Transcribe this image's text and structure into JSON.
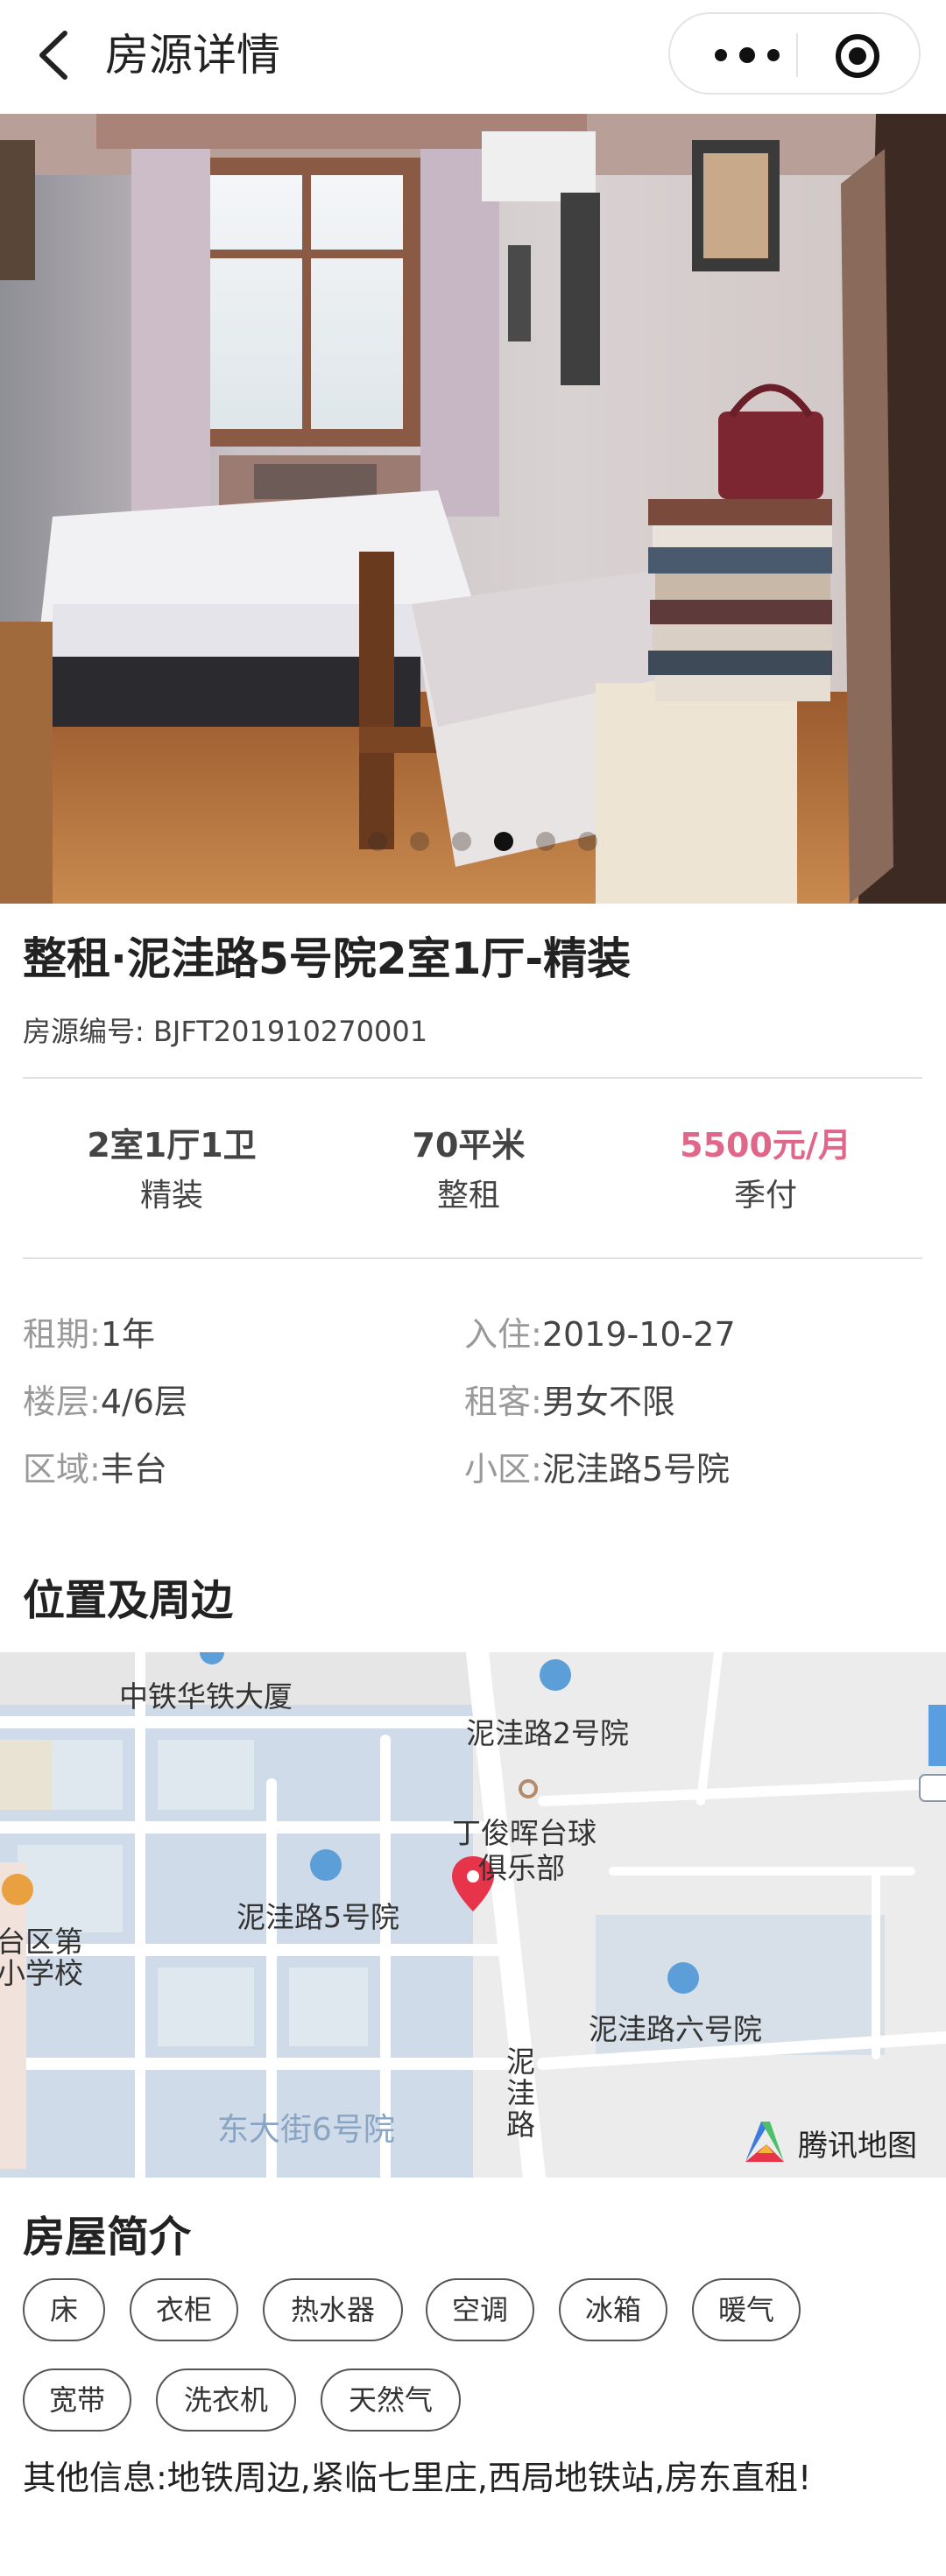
{
  "nav": {
    "title": "房源详情"
  },
  "carousel": {
    "total": 6,
    "active_index": 3
  },
  "listing": {
    "title": "整租·泥洼路5号院2室1厅-精装",
    "code_label": "房源编号:",
    "code_value": "BJFT201910270001"
  },
  "stats": [
    {
      "main": "2室1厅1卫",
      "sub": "精装"
    },
    {
      "main": "70平米",
      "sub": "整租"
    },
    {
      "main": "5500元/月",
      "sub": "季付"
    }
  ],
  "details": [
    {
      "key": "租期:",
      "value": "1年"
    },
    {
      "key": "入住:",
      "value": "2019-10-27"
    },
    {
      "key": "楼层:",
      "value": "4/6层"
    },
    {
      "key": "租客:",
      "value": "男女不限"
    },
    {
      "key": "区域:",
      "value": "丰台"
    },
    {
      "key": "小区:",
      "value": "泥洼路5号院"
    }
  ],
  "location_section": {
    "title": "位置及周边"
  },
  "map": {
    "labels": {
      "zhongtie": "中铁华铁大厦",
      "niwa2": "泥洼路2号院",
      "billiards1": "丁俊晖台球",
      "billiards2": "俱乐部",
      "niwa5": "泥洼路5号院",
      "school1": "台区第",
      "school2": "小学校",
      "niwa6": "泥洼路六号院",
      "road": "泥洼路",
      "dongdajie": "东大街6号院",
      "provider": "腾讯地图"
    },
    "accent_color": "#e8344a"
  },
  "intro": {
    "title": "房屋简介",
    "tags": [
      "床",
      "衣柜",
      "热水器",
      "空调",
      "冰箱",
      "暖气",
      "宽带",
      "洗衣机",
      "天然气"
    ],
    "other_info": "其他信息:地铁周边,紧临七里庄,西局地铁站,房东直租!"
  }
}
